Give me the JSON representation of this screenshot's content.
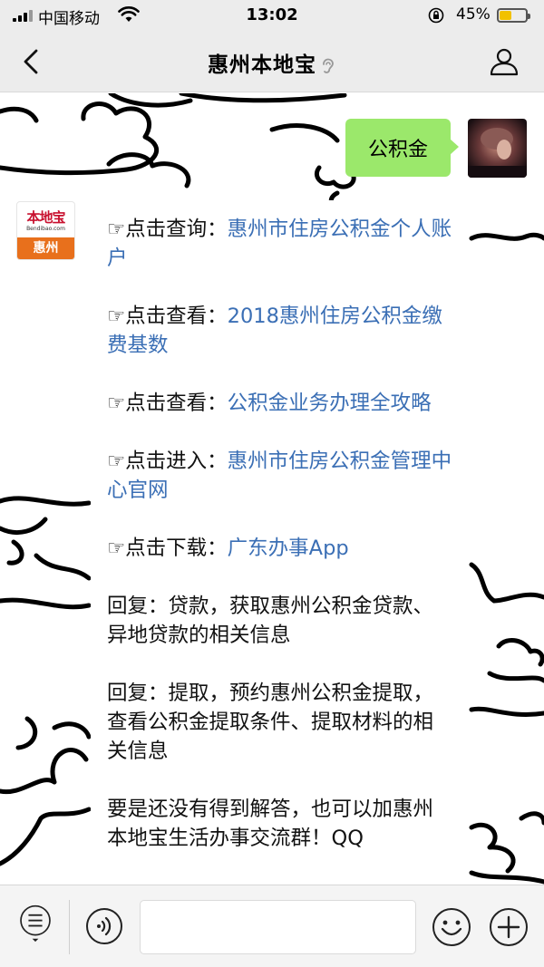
{
  "status_bar": {
    "carrier": "中国移动",
    "time": "13:02",
    "battery_percent": "45%",
    "battery_level": 0.45,
    "icons": [
      "signal-icon",
      "wifi-icon",
      "orientation-lock-icon",
      "battery-icon"
    ]
  },
  "header": {
    "title": "惠州本地宝",
    "icons": [
      "back-arrow-icon",
      "listen-icon",
      "profile-icon"
    ]
  },
  "chat": {
    "outgoing": {
      "text": "公积金"
    },
    "incoming": {
      "avatar": {
        "logo_text": "本地宝",
        "logo_subtext": "Bendibao.com",
        "logo_band": "惠州"
      },
      "items": [
        {
          "prefix": "☞点击查询：",
          "link": "惠州市住房公积金个人账户"
        },
        {
          "prefix": "☞点击查看：",
          "link": "2018惠州住房公积金缴费基数"
        },
        {
          "prefix": "☞点击查看：",
          "link": "公积金业务办理全攻略"
        },
        {
          "prefix": "☞点击进入：",
          "link": "惠州市住房公积金管理中心官网"
        },
        {
          "prefix": "☞点击下载：",
          "link": "广东办事App"
        }
      ],
      "paragraphs": [
        "回复：贷款，获取惠州公积金贷款、异地贷款的相关信息",
        "回复：提取，预约惠州公积金提取，查看公积金提取条件、提取材料的相关信息",
        "要是还没有得到解答，也可以加惠州本地宝生活办事交流群！QQ"
      ]
    }
  },
  "input_bar": {
    "value": "",
    "icons": [
      "menu-list-icon",
      "voice-icon",
      "emoji-icon",
      "plus-icon"
    ]
  },
  "colors": {
    "bar_bg": "#ececec",
    "outgoing_bubble": "#9be86b",
    "link": "#3b6fb5",
    "battery": "#f2c100",
    "logo_red": "#c8102e",
    "logo_orange": "#e8701c"
  }
}
